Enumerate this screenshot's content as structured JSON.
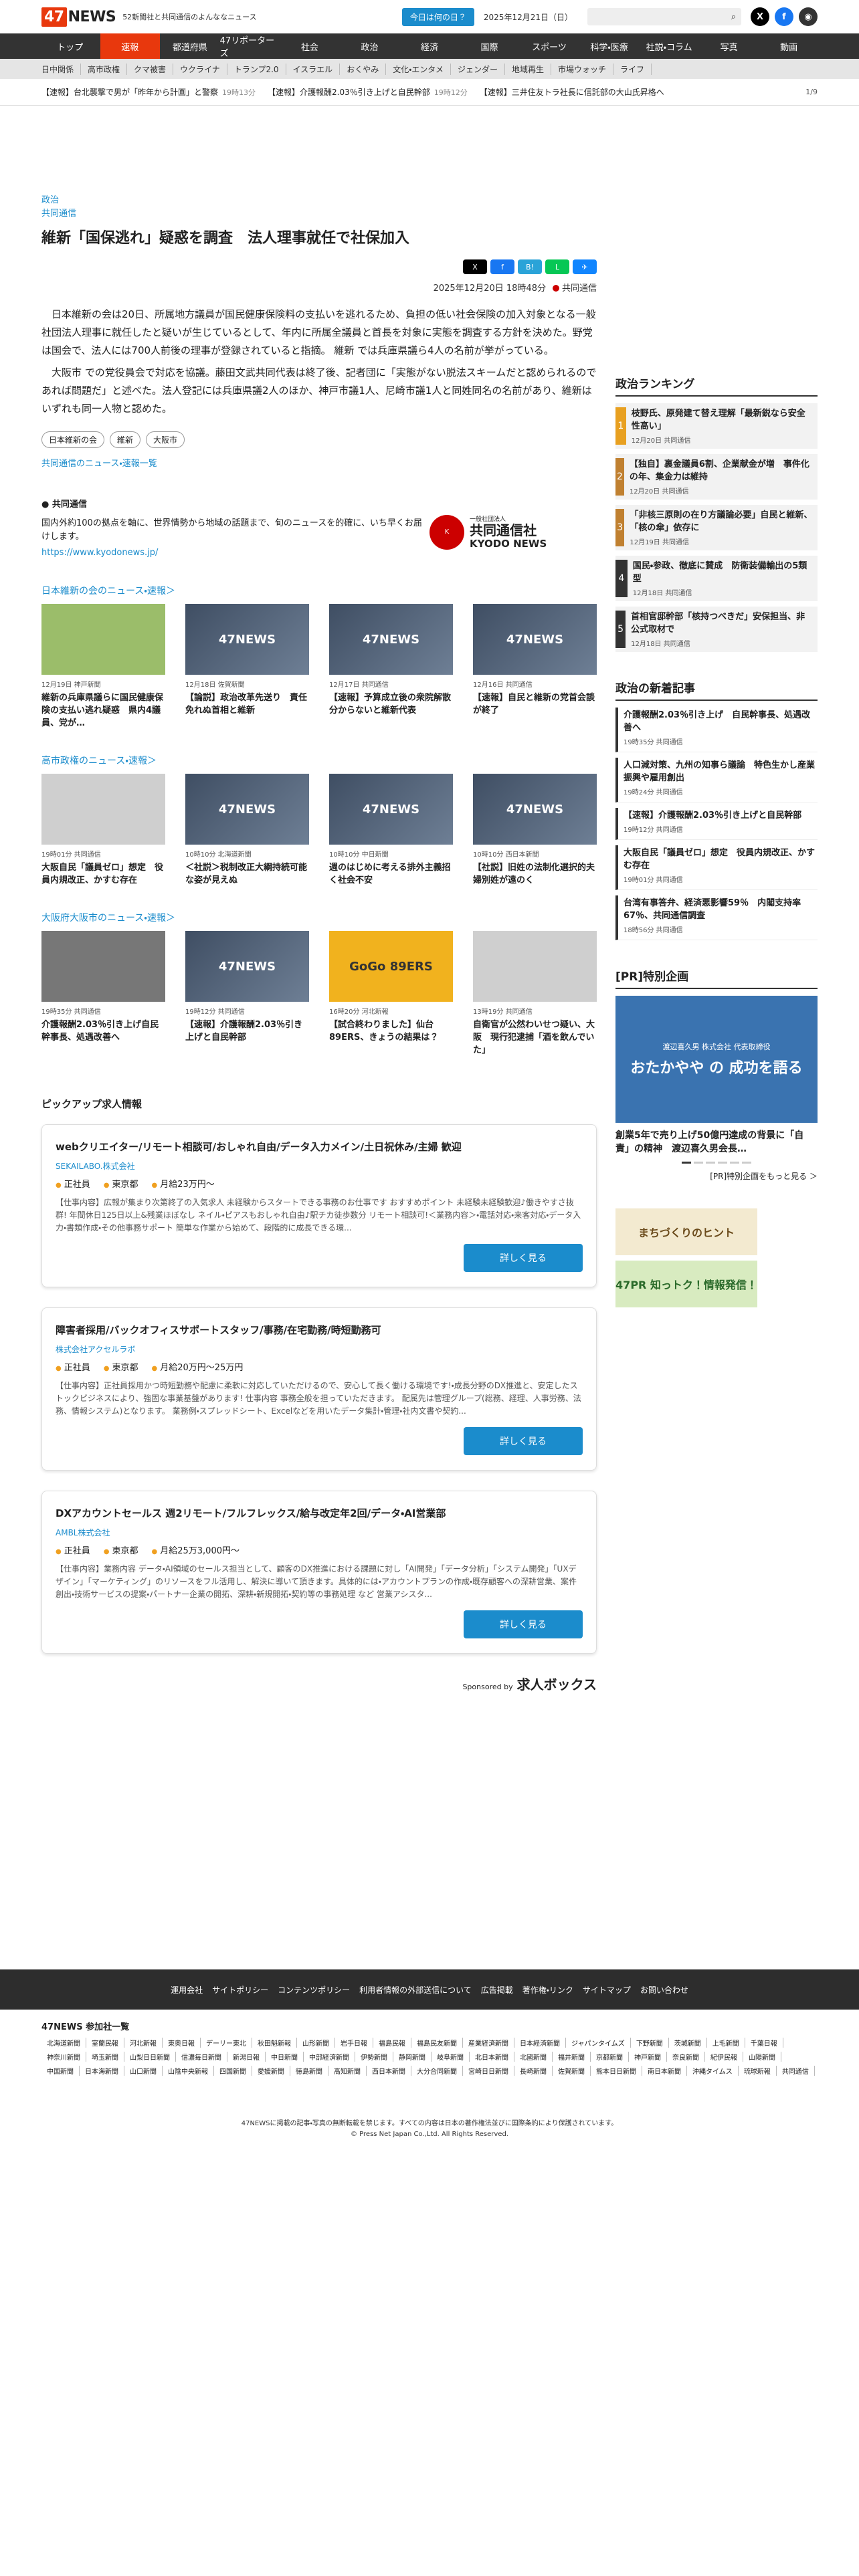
{
  "header": {
    "logo_mark": "47",
    "logo_text": "NEWS",
    "tagline": "52新聞社と共同通信のよんななニュース",
    "today_button": "今日は何の日？",
    "date": "2025年12月21日（日）",
    "search_icon": "search-icon"
  },
  "nav_main": [
    "トップ",
    "速報",
    "都道府県",
    "47リポーターズ",
    "社会",
    "政治",
    "経済",
    "国際",
    "スポーツ",
    "科学・医療",
    "社説・コラム",
    "写真",
    "動画"
  ],
  "nav_sub": [
    "日中関係",
    "高市政権",
    "クマ被害",
    "ウクライナ",
    "トランプ2.0",
    "イスラエル",
    "おくやみ",
    "文化・エンタメ",
    "ジェンダー",
    "地域再生",
    "市場ウォッチ",
    "ライフ"
  ],
  "ticker": [
    {
      "text": "【速報】台北襲撃で男が「昨年から計画」と警察",
      "time": "19時13分"
    },
    {
      "text": "【速報】介護報酬2.03％引き上げと自民幹部",
      "time": "19時12分"
    },
    {
      "text": "【速報】三井住友トラ社長に信託部の大山氏昇格へ",
      "time": ""
    }
  ],
  "ticker_page": "1/9",
  "article": {
    "category": "政治",
    "source_link": "共同通信",
    "headline": "維新「国保逃れ」疑惑を調査　法人理事就任で社保加入",
    "date": "2025年12月20日 18時48分",
    "source": "共同通信",
    "paragraphs": [
      "日本維新の会は20日、所属地方議員が国民健康保険料の支払いを逃れるため、負担の低い社会保険の加入対象となる一般社団法人理事に就任したと疑いが生じているとして、年内に所属全議員と首長を対象に実態を調査する方針を決めた。野党は国会で、法人には700人前後の理事が登録されていると指摘。 維新 では兵庫県議ら4人の名前が挙がっている。",
      "大阪市 での党役員会で対応を協議。藤田文武共同代表は終了後、記者団に「実態がない脱法スキームだと認められるのであれば問題だ」と述べた。法人登記には兵庫県議2人のほか、神戸市議1人、尼崎市議1人と同姓同名の名前があり、維新はいずれも同一人物と認めた。"
    ],
    "tags": [
      "日本維新の会",
      "維新",
      "大阪市"
    ],
    "more": "共同通信のニュース・速報一覧"
  },
  "kyodo": {
    "name": "共同通信",
    "desc": "国内外約100の拠点を軸に、世界情勢から地域の話題まで、旬のニュースを的確に、いち早くお届けします。",
    "url": "https://www.kyodonews.jp/",
    "logo_small": "一般社団法人",
    "logo_name": "共同通信社",
    "logo_en": "KYODO NEWS"
  },
  "sections": [
    {
      "title": "日本維新の会のニュース・速報＞",
      "items": [
        {
          "img": "photo1",
          "label": "",
          "meta": "12月19日 神戸新聞",
          "title": "維新の兵庫県議らに国民健康保険の支払い逃れ疑惑　県内4議員、党が…"
        },
        {
          "img": "news",
          "label": "47NEWS",
          "meta": "12月18日 佐賀新聞",
          "title": "【論説】政治改革先送り　責任免れぬ首相と維新"
        },
        {
          "img": "news",
          "label": "47NEWS",
          "meta": "12月17日 共同通信",
          "title": "【速報】予算成立後の衆院解散分からないと維新代表"
        },
        {
          "img": "news",
          "label": "47NEWS",
          "meta": "12月16日 共同通信",
          "title": "【速報】自民と維新の党首会談が終了"
        }
      ]
    },
    {
      "title": "高市政権のニュース・速報＞",
      "items": [
        {
          "img": "photo2",
          "label": "",
          "meta": "19時01分 共同通信",
          "title": "大阪自民「議員ゼロ」想定　役員内規改正、かすむ存在"
        },
        {
          "img": "news",
          "label": "47NEWS",
          "meta": "10時10分 北海道新聞",
          "title": "＜社説＞税制改正大綱持続可能な姿が見えぬ"
        },
        {
          "img": "news",
          "label": "47NEWS",
          "meta": "10時10分 中日新聞",
          "title": "週のはじめに考える排外主義招く社会不安"
        },
        {
          "img": "news",
          "label": "47NEWS",
          "meta": "10時10分 西日本新聞",
          "title": "【社説】旧姓の法制化選択的夫婦別姓が遠のく"
        }
      ]
    },
    {
      "title": "大阪府大阪市のニュース・速報＞",
      "items": [
        {
          "img": "photo4",
          "label": "",
          "meta": "19時35分 共同通信",
          "title": "介護報酬2.03％引き上げ自民幹事長、処遇改善へ"
        },
        {
          "img": "news",
          "label": "47NEWS",
          "meta": "19時12分 共同通信",
          "title": "【速報】介護報酬2.03％引き上げと自民幹部"
        },
        {
          "img": "photo3",
          "label": "GoGo 89ERS",
          "meta": "16時20分 河北新報",
          "title": "【試合終わりました】仙台89ERS、きょうの結果は？"
        },
        {
          "img": "photo2",
          "label": "",
          "meta": "13時19分 共同通信",
          "title": "自衛官が公然わいせつ疑い、大阪　現行犯逮捕「酒を飲んでいた」"
        }
      ]
    }
  ],
  "jobs": {
    "title": "ピックアップ求人情報",
    "items": [
      {
        "title": "webクリエイター/リモート相談可/おしゃれ自由/データ入力メイン/土日祝休み/主婦 歓迎",
        "company": "SEKAILABO.株式会社",
        "type": "正社員",
        "place": "東京都",
        "salary": "月給23万円〜",
        "desc": "【仕事内容】広報が集まり次第終了の入気求人 未経験からスタートできる事務のお仕事です おすすめポイント 未経験未経験歓迎♪働きやすさ抜群! 年間休日125日以上&残業ほぼなし ネイル・ピアスもおしゃれ自由♪駅チカ徒歩数分 リモート相談可!＜業務内容＞・電話対応・来客対応・データ入力・書類作成・その他事務サポート 簡単な作業から始めて、段階的に成長できる環...",
        "button": "詳しく見る"
      },
      {
        "title": "障害者採用/バックオフィスサポートスタッフ/事務/在宅勤務/時短勤務可",
        "company": "株式会社アクセルラボ",
        "type": "正社員",
        "place": "東京都",
        "salary": "月給20万円〜25万円",
        "desc": "【仕事内容】正社員採用かつ時短勤務や配慮に柔軟に対応していただけるので、安心して長く働ける環境です!・成長分野のDX推進と、安定したストックビジネスにより、強固な事業基盤があります! 仕事内容 事務全般を担っていただきます。 配属先は管理グループ(総務、経理、人事労務、法務、情報システム)となります。 業務例・スプレッドシート、Excelなどを用いたデータ集計・管理・社内文書や契約...",
        "button": "詳しく見る"
      },
      {
        "title": "DXアカウントセールス 週2リモート/フルフレックス/給与改定年2回/データ・AI営業部",
        "company": "AMBL株式会社",
        "type": "正社員",
        "place": "東京都",
        "salary": "月給25万3,000円〜",
        "desc": "【仕事内容】業務内容 データ・AI領域のセールス担当として、顧客のDX推進における課題に対し「AI開発」「データ分析」「システム開発」「UXデザイン」「マーケティング」のリソースをフル活用し、解決に導いて頂きます。具体的には・アカウントプランの作成・既存顧客への深耕営業、案件創出・技術サービスの提案・パートナー企業の開拓、深耕・新規開拓・契約等の事務処理 など 営業アシスタ...",
        "button": "詳しく見る"
      }
    ],
    "sponsor": "Sponsored by",
    "sponsor_name": "求人ボックス"
  },
  "ranking": {
    "title": "政治ランキング",
    "items": [
      {
        "n": "1",
        "title": "枝野氏、原発建て替え理解「最新鋭なら安全性高い」",
        "meta": "12月20日 共同通信"
      },
      {
        "n": "2",
        "title": "【独自】裏金議員6割、企業献金が増　事件化の年、集金力は維持",
        "meta": "12月20日 共同通信"
      },
      {
        "n": "3",
        "title": "「非核三原則の在り方議論必要」自民と維新、「核の傘」依存に",
        "meta": "12月19日 共同通信"
      },
      {
        "n": "4",
        "title": "国民・参政、徹底に賛成　防衛装備輸出の5類型",
        "meta": "12月18日 共同通信"
      },
      {
        "n": "5",
        "title": "首相官邸幹部「核持つべきだ」安保担当、非公式取材で",
        "meta": "12月18日 共同通信"
      }
    ]
  },
  "newest": {
    "title": "政治の新着記事",
    "items": [
      {
        "title": "介護報酬2.03％引き上げ　自民幹事長、処遇改善へ",
        "meta": "19時35分 共同通信"
      },
      {
        "title": "人口減対策、九州の知事ら議論　特色生かし産業振興や雇用創出",
        "meta": "19時24分 共同通信"
      },
      {
        "title": "【速報】介護報酬2.03％引き上げと自民幹部",
        "meta": "19時12分 共同通信"
      },
      {
        "title": "大阪自民「議員ゼロ」想定　役員内規改正、かすむ存在",
        "meta": "19時01分 共同通信"
      },
      {
        "title": "台湾有事答弁、経済悪影響59％　内閣支持率67％、共同通信調査",
        "meta": "18時56分 共同通信"
      }
    ]
  },
  "pr": {
    "title": "[PR]特別企画",
    "banner_top": "渡辺喜久男 株式会社 代表取締役",
    "banner_main": "おたかやや の 成功を語る",
    "caption": "創業5年で売り上げ50億円達成の背景に「自責」の精神　渡辺喜久男会長…",
    "more": "[PR]特別企画をもっと見る ＞",
    "ad1": "まちづくりのヒント",
    "ad2": "47PR 知っトク！情報発信！"
  },
  "footer": {
    "links": [
      "運用会社",
      "サイトポリシー",
      "コンテンツポリシー",
      "利用者情報の外部送信について",
      "広告掲載",
      "著作権・リンク",
      "サイトマップ",
      "お問い合わせ"
    ],
    "members_title": "47NEWS 参加社一覧",
    "members": [
      "北海道新聞",
      "室蘭民報",
      "河北新報",
      "東奥日報",
      "デーリー東北",
      "秋田魁新報",
      "山形新聞",
      "岩手日報",
      "福島民報",
      "福島民友新聞",
      "産業経済新聞",
      "日本経済新聞",
      "ジャパンタイムズ",
      "下野新聞",
      "茨城新聞",
      "上毛新聞",
      "千葉日報",
      "神奈川新聞",
      "埼玉新聞",
      "山梨日日新聞",
      "信濃毎日新聞",
      "新潟日報",
      "中日新聞",
      "中部経済新聞",
      "伊勢新聞",
      "静岡新聞",
      "岐阜新聞",
      "北日本新聞",
      "北國新聞",
      "福井新聞",
      "京都新聞",
      "神戸新聞",
      "奈良新聞",
      "紀伊民報",
      "山陽新聞",
      "中国新聞",
      "日本海新聞",
      "山口新聞",
      "山陰中央新報",
      "四国新聞",
      "愛媛新聞",
      "徳島新聞",
      "高知新聞",
      "西日本新聞",
      "大分合同新聞",
      "宮崎日日新聞",
      "長崎新聞",
      "佐賀新聞",
      "熊本日日新聞",
      "南日本新聞",
      "沖縄タイムス",
      "琉球新報",
      "共同通信"
    ],
    "copy1": "47NEWSに掲載の記事・写真の無断転載を禁じます。すべての内容は日本の著作権法並びに国際条約により保護されています。",
    "copy2": "© Press Net Japan Co.,Ltd. All Rights Reserved."
  },
  "colors": {
    "accent": "#e8380d",
    "link": "#1b8ccc",
    "nav": "#333333"
  }
}
